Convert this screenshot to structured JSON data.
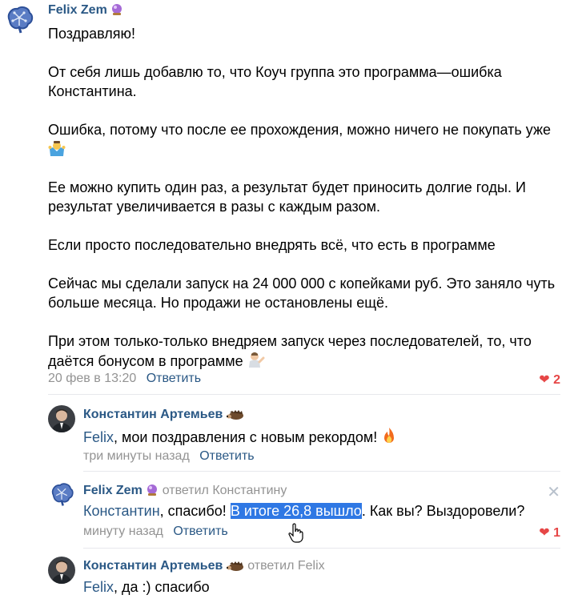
{
  "post": {
    "author": "Felix Zem",
    "author_badge": "crystal-ball",
    "paragraphs": [
      [
        "Поздравляю!"
      ],
      [
        "От себя лишь добавлю то, что Коуч группа это программа—ошибка",
        "Константина."
      ],
      [
        "Ошибка, потому что после ее прохождения, можно ничего не покупать уже"
      ],
      [
        "Ее можно купить один раз, а результат будет приносить долгие годы. И",
        "результат увеличивается в разы с каждым разом."
      ],
      [
        "Если просто последовательно внедрять всё, что есть в программе"
      ],
      [
        "Сейчас мы сделали запуск на 24 000 000 с копейками руб. Это заняло чуть",
        "больше месяца. Но продажи не остановлены ещё."
      ],
      [
        "При этом только-только внедряем запуск через последователей, то, что",
        "даётся бонусом в программе"
      ]
    ],
    "date": "20 фев в 13:20",
    "reply_label": "Ответить",
    "likes": "2"
  },
  "replies": [
    {
      "author": "Константин Артемьев",
      "mention": "Felix",
      "text": ", мои поздравления с новым рекордом!",
      "time": "три минуты назад",
      "reply_label": "Ответить"
    },
    {
      "author": "Felix Zem",
      "replied_to": "ответил Константину",
      "mention": "Константин",
      "text_before": ", спасибо! ",
      "text_selected": "В итоге 26,8 вышло",
      "text_after": ". Как вы? Выздоровели?",
      "time": "минуту назад",
      "reply_label": "Ответить",
      "likes": "1"
    },
    {
      "author": "Константин Артемьев",
      "replied_to": "ответил Felix",
      "mention": "Felix",
      "text": ", да :) спасибо"
    }
  ],
  "colors": {
    "link": "#2a5885",
    "meta": "#939393",
    "like": "#e64646",
    "selection": "#2f78e4"
  },
  "icons": [
    "brain-avatar-icon",
    "crystal-ball-icon",
    "shrug-emoji-icon",
    "tipping-hand-emoji-icon",
    "heart-icon",
    "hedgehog-icon",
    "fire-emoji-icon",
    "close-icon",
    "hand-cursor-icon"
  ]
}
